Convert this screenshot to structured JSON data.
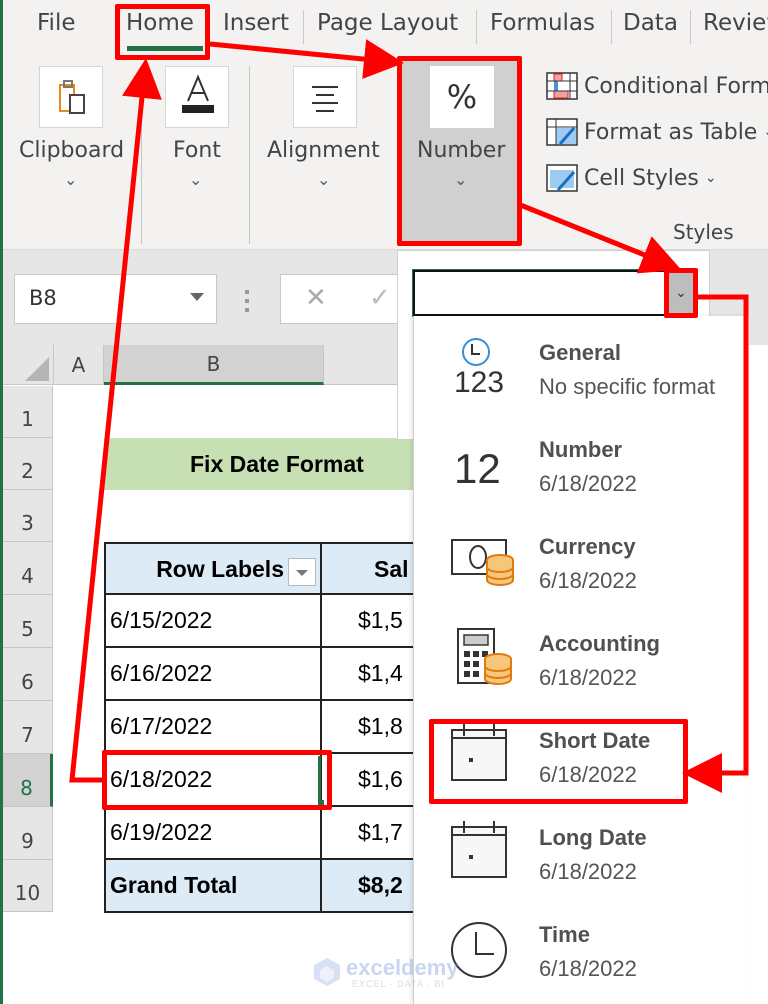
{
  "ribbon_tabs": [
    {
      "label": "File"
    },
    {
      "label": "Home"
    },
    {
      "label": "Insert"
    },
    {
      "label": "Page Layout"
    },
    {
      "label": "Formulas"
    },
    {
      "label": "Data"
    },
    {
      "label": "Review"
    }
  ],
  "active_tab": "Home",
  "ribbon_groups": {
    "clipboard": {
      "label": "Clipboard",
      "icon": "clipboard-icon"
    },
    "font": {
      "label": "Font",
      "icon": "font-color-icon"
    },
    "alignment": {
      "label": "Alignment",
      "icon": "align-center-icon"
    },
    "number": {
      "label": "Number",
      "icon": "percent-icon",
      "glyph": "%"
    },
    "styles": {
      "label": "Styles",
      "items": [
        {
          "label": "Conditional Formatting",
          "icon": "conditional-formatting-icon"
        },
        {
          "label": "Format as Table",
          "icon": "format-as-table-icon"
        },
        {
          "label": "Cell Styles",
          "icon": "cell-styles-icon"
        }
      ]
    }
  },
  "formula_bar": {
    "name_box": "B8",
    "cancel_glyph": "✕",
    "enter_glyph": "✓"
  },
  "grid": {
    "columns": [
      "A",
      "B"
    ],
    "rows": [
      "1",
      "2",
      "3",
      "4",
      "5",
      "6",
      "7",
      "8",
      "9",
      "10"
    ],
    "selected_row": "8",
    "selected_column": "B"
  },
  "sheet": {
    "title": "Fix Date Format",
    "pivot": {
      "headers": [
        "Row Labels",
        "Sal"
      ],
      "rows": [
        [
          "6/15/2022",
          "$1,5"
        ],
        [
          "6/16/2022",
          "$1,4"
        ],
        [
          "6/17/2022",
          "$1,8"
        ],
        [
          "6/18/2022",
          "$1,6"
        ],
        [
          "6/19/2022",
          "$1,7"
        ]
      ],
      "total": [
        "Grand Total",
        "$8,2"
      ]
    }
  },
  "number_format_dropdown": {
    "current_value": "",
    "options": [
      {
        "title": "General",
        "sample": "No specific format",
        "icon": "general-clock-123-icon"
      },
      {
        "title": "Number",
        "sample": "6/18/2022",
        "icon": "number-12-icon"
      },
      {
        "title": "Currency",
        "sample": "6/18/2022",
        "icon": "currency-icon"
      },
      {
        "title": "Accounting",
        "sample": " 6/18/2022",
        "icon": "accounting-calculator-icon"
      },
      {
        "title": "Short Date",
        "sample": "6/18/2022",
        "icon": "calendar-icon",
        "highlighted": true
      },
      {
        "title": "Long Date",
        "sample": "6/18/2022",
        "icon": "calendar-icon"
      },
      {
        "title": "Time",
        "sample": "6/18/2022",
        "icon": "clock-icon"
      }
    ]
  },
  "watermark": {
    "brand": "exceldemy",
    "tagline": "EXCEL · DATA · BI"
  },
  "colors": {
    "excel_green": "#217346",
    "annotation_red": "#ff0000",
    "title_fill": "#c6e0b4",
    "pivot_header_fill": "#ddebf7"
  }
}
